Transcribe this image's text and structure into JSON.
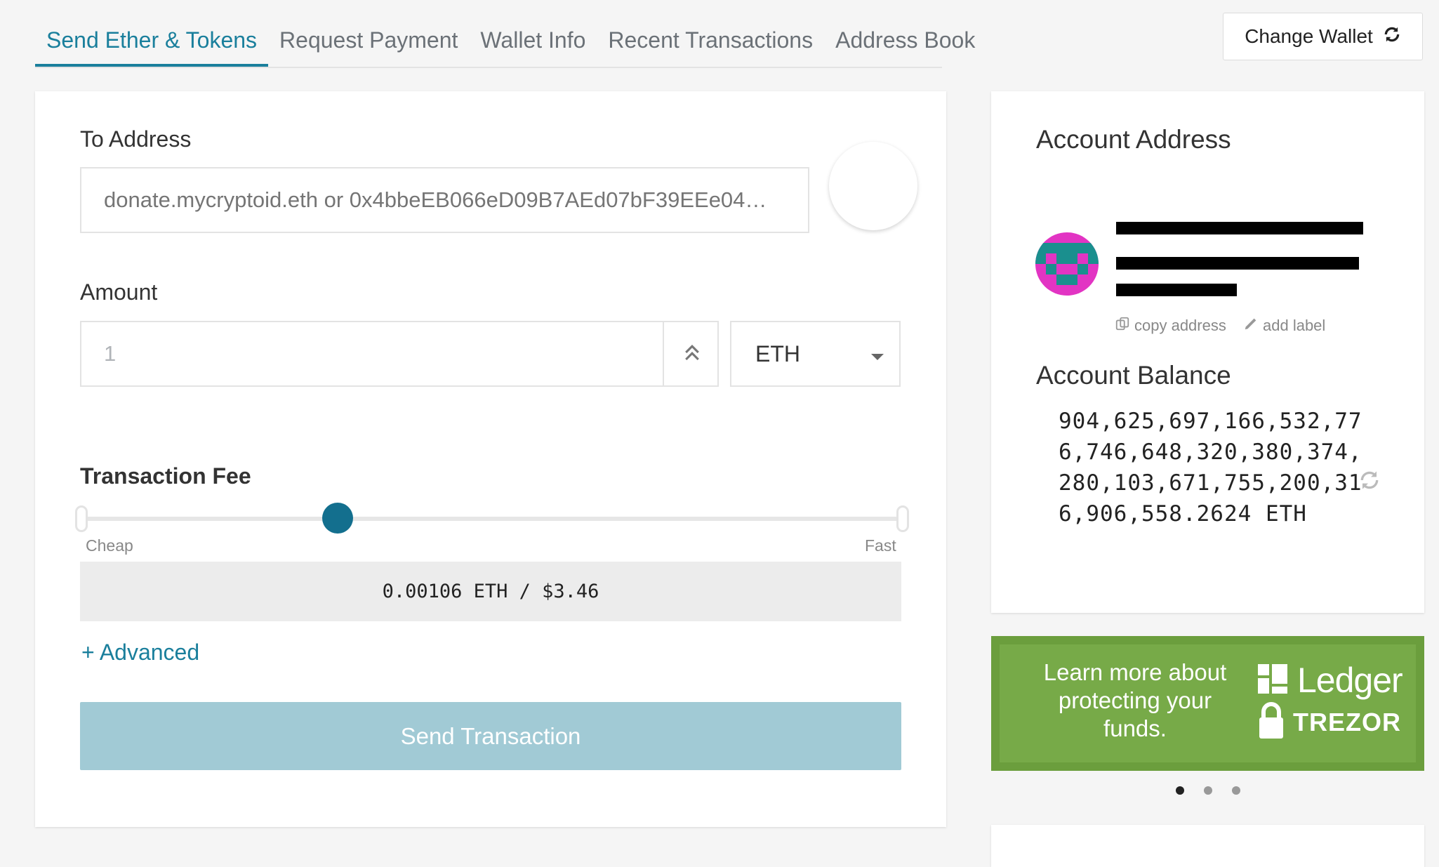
{
  "nav": {
    "tabs": [
      {
        "label": "Send Ether & Tokens",
        "active": true
      },
      {
        "label": "Request Payment",
        "active": false
      },
      {
        "label": "Wallet Info",
        "active": false
      },
      {
        "label": "Recent Transactions",
        "active": false
      },
      {
        "label": "Address Book",
        "active": false
      }
    ],
    "change_wallet_label": "Change Wallet",
    "change_wallet_icon": "refresh-icon"
  },
  "send_form": {
    "to_address_label": "To Address",
    "to_address_placeholder": "donate.mycryptoid.eth or 0x4bbeEB066eD09B7AEd07bF39EEe04…",
    "amount_label": "Amount",
    "amount_value": "1",
    "unit": "ETH",
    "fee_label": "Transaction Fee",
    "fee_slider_level": 0.31,
    "fee_cheap_label": "Cheap",
    "fee_fast_label": "Fast",
    "fee_display": "0.00106 ETH / $3.46",
    "advanced_label": "+ Advanced",
    "send_button_label": "Send Transaction"
  },
  "account": {
    "address_title": "Account Address",
    "address_redacted": true,
    "copy_address_label": "copy address",
    "add_label_label": "add label",
    "balance_title": "Account Balance",
    "balance_text": "904,625,697,166,532,776,746,648,320,380,374,280,103,671,755,200,316,906,558.2624 ETH"
  },
  "promo": {
    "text": "Learn more about protecting your funds.",
    "brand_1": "Ledger",
    "brand_2": "TREZOR",
    "carousel_active_index": 0,
    "carousel_count": 3
  },
  "colors": {
    "accent": "#1a7f9c",
    "slider_thumb": "#136f8e",
    "send_button_disabled": "#a1cad5",
    "promo_green": "#77aa48"
  }
}
